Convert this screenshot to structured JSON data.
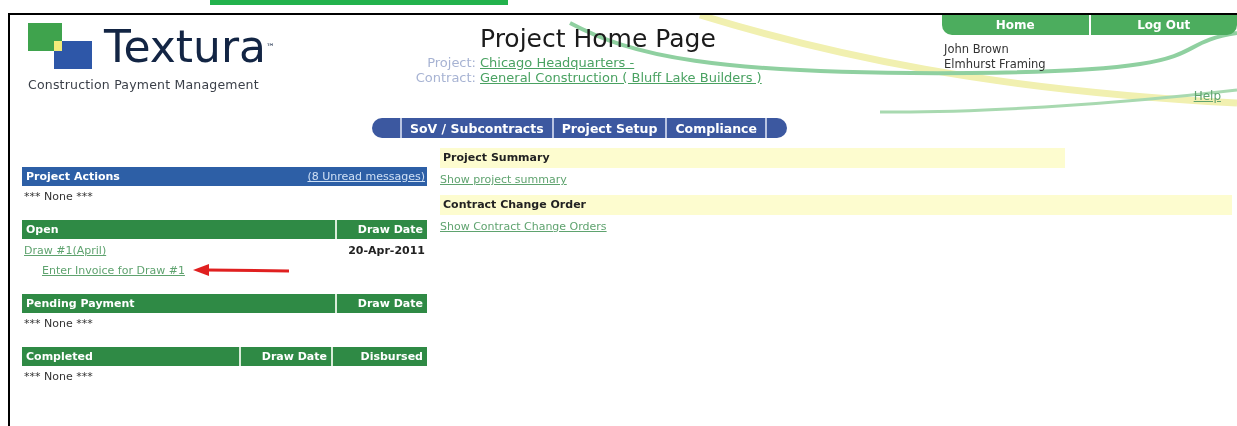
{
  "header": {
    "logo": {
      "name": "Textura",
      "trademark": "™",
      "tagline": "Construction Payment Management"
    },
    "title": "Project Home Page",
    "info": [
      {
        "label": "Project:",
        "value": "Chicago Headquarters -"
      },
      {
        "label": "Contract:",
        "value": "General Construction ( Bluff Lake Builders )"
      }
    ],
    "user_name": "John Brown",
    "company": "Elmhurst Framing",
    "top_nav": [
      "Home",
      "Log Out"
    ],
    "help": "Help"
  },
  "tabs": [
    {
      "label": "SoV / Subcontracts",
      "selected": false
    },
    {
      "label": "Project Setup",
      "selected": false
    },
    {
      "label": "Compliance",
      "selected": false
    }
  ],
  "panels": [
    {
      "kind": "actions",
      "title": "Project Actions",
      "link": "(8 Unread messages)",
      "empty": "*** None ***"
    },
    {
      "kind": "table",
      "columns": [
        "Open",
        "Draw Date"
      ],
      "rows": [
        {
          "draw": "Draw #1(April)",
          "date": "20-Apr-2011",
          "action": "Enter Invoice for Draw #1"
        }
      ]
    },
    {
      "kind": "table",
      "columns": [
        "Pending Payment",
        "Draw Date"
      ],
      "empty": "*** None ***"
    },
    {
      "kind": "table",
      "columns": [
        "Completed",
        "Draw Date",
        "Disbursed"
      ],
      "empty": "*** None ***"
    }
  ],
  "sections": [
    {
      "title": "Project Summary",
      "link": "Show project summary"
    },
    {
      "title": "Contract Change Order",
      "link": "Show Contract Change Orders"
    }
  ]
}
